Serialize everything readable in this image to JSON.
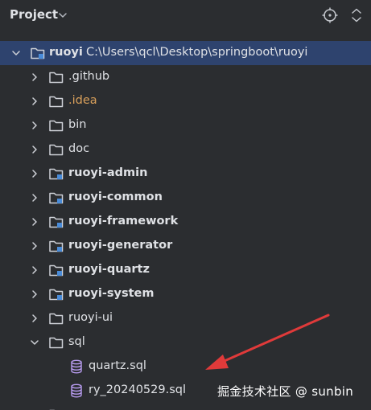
{
  "header": {
    "title": "Project",
    "actions": [
      "locate-icon",
      "expand-collapse-icon"
    ]
  },
  "tree": {
    "root": {
      "name": "ruoyi",
      "path": "C:\\Users\\qcl\\Desktop\\springboot\\ruoyi"
    },
    "children": [
      {
        "name": ".github"
      },
      {
        "name": ".idea"
      },
      {
        "name": "bin"
      },
      {
        "name": "doc"
      },
      {
        "name": "ruoyi-admin"
      },
      {
        "name": "ruoyi-common"
      },
      {
        "name": "ruoyi-framework"
      },
      {
        "name": "ruoyi-generator"
      },
      {
        "name": "ruoyi-quartz"
      },
      {
        "name": "ruoyi-system"
      },
      {
        "name": "ruoyi-ui"
      },
      {
        "name": "sql"
      }
    ],
    "sql_files": [
      {
        "name": "quartz.sql"
      },
      {
        "name": "ry_20240529.sql"
      }
    ]
  },
  "watermark": "掘金技术社区 @ sunbin",
  "colors": {
    "background": "#2b2d30",
    "selected_row": "#2e436e",
    "text": "#dfe1e5",
    "idea_text": "#d9a05b",
    "annotation_arrow": "#e03a3a"
  }
}
